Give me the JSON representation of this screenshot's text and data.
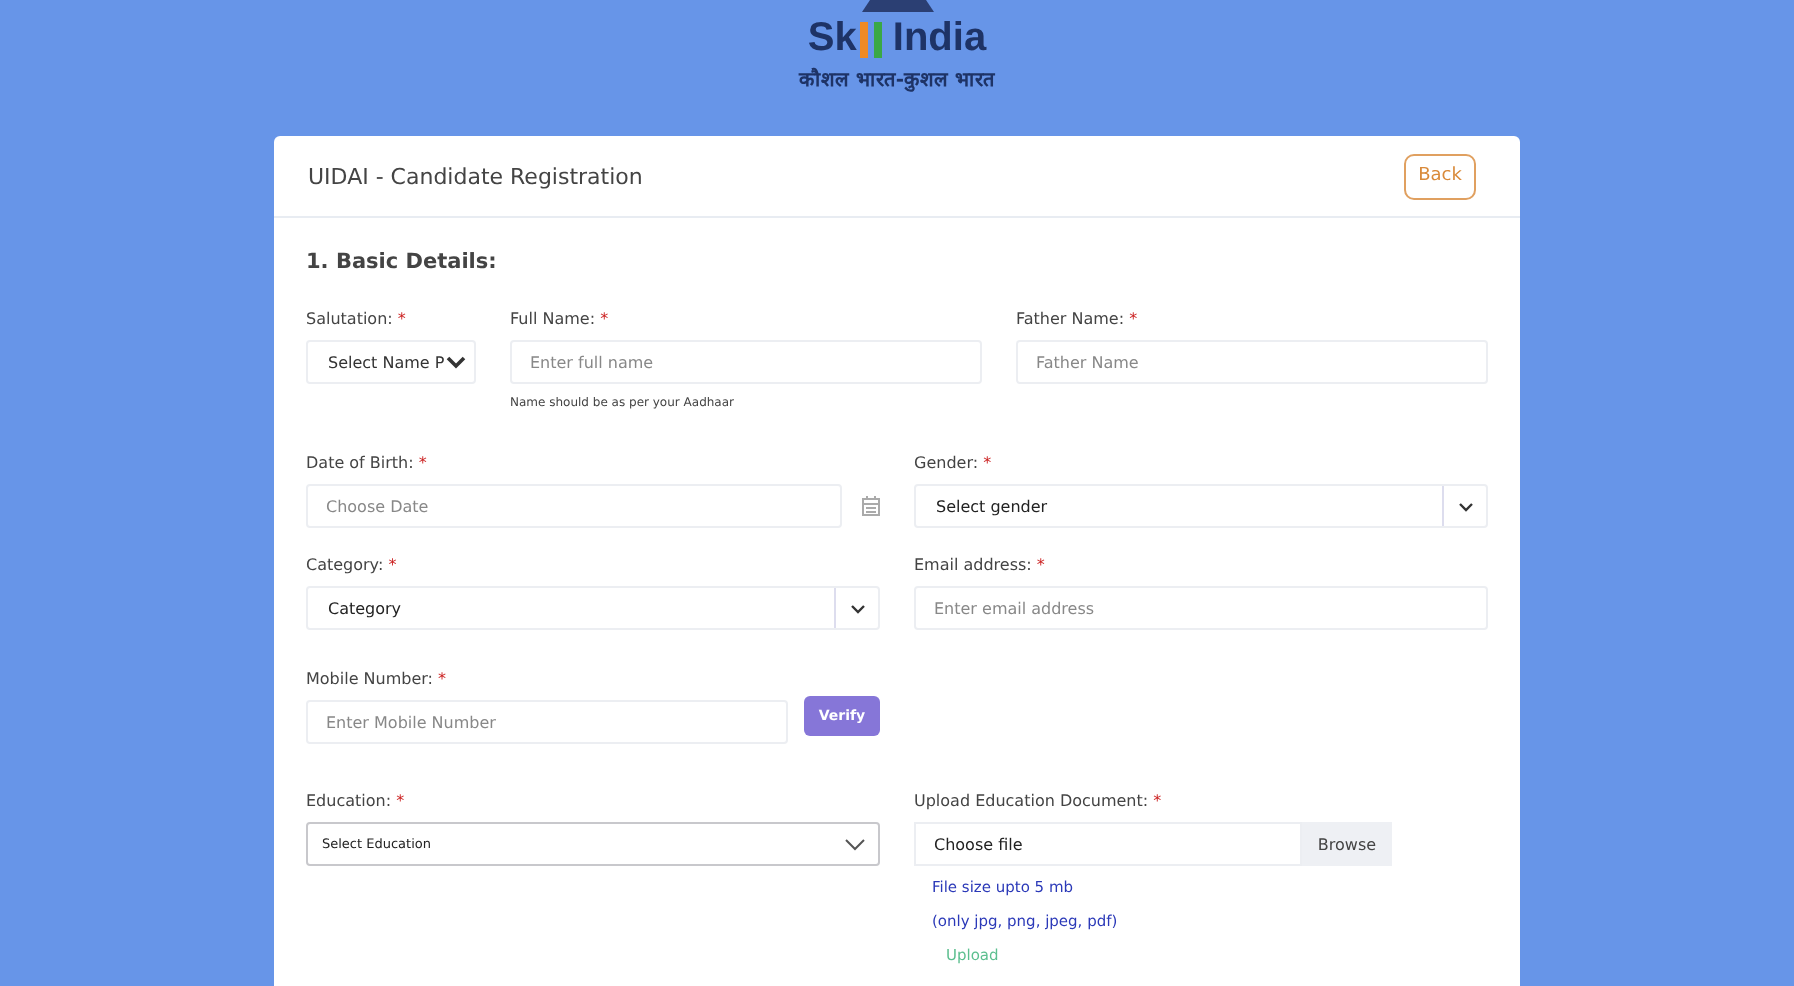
{
  "logo": {
    "prefix": "Sk",
    "suffix": "India",
    "tagline": "कौशल भारत-कुशल भारत"
  },
  "card": {
    "title": "UIDAI - Candidate Registration",
    "back_button": "Back"
  },
  "section": {
    "title": "1. Basic Details:"
  },
  "salutation": {
    "label": "Salutation:",
    "required_mark": "*",
    "value": "Select Name P"
  },
  "full_name": {
    "label": "Full Name:",
    "required_mark": "*",
    "placeholder": "Enter full name",
    "hint": "Name should be as per your Aadhaar"
  },
  "father_name": {
    "label": "Father Name:",
    "required_mark": "*",
    "placeholder": "Father Name"
  },
  "date_of_birth": {
    "label": "Date of Birth:",
    "required_mark": "*",
    "placeholder": "Choose Date"
  },
  "gender": {
    "label": "Gender:",
    "required_mark": "*",
    "value": "Select gender"
  },
  "category": {
    "label": "Category:",
    "required_mark": "*",
    "value": "Category"
  },
  "email": {
    "label": "Email address:",
    "required_mark": "*",
    "placeholder": "Enter email address"
  },
  "mobile": {
    "label": "Mobile Number:",
    "required_mark": "*",
    "placeholder": "Enter Mobile Number",
    "verify_button": "Verify"
  },
  "education": {
    "label": "Education:",
    "required_mark": "*",
    "value": "Select Education"
  },
  "upload": {
    "label": "Upload Education Document:",
    "required_mark": "*",
    "file_text": "Choose file",
    "browse_button": "Browse",
    "size_note": "File size upto 5 mb",
    "types_note": "(only jpg, png, jpeg, pdf)",
    "upload_button": "Upload"
  }
}
